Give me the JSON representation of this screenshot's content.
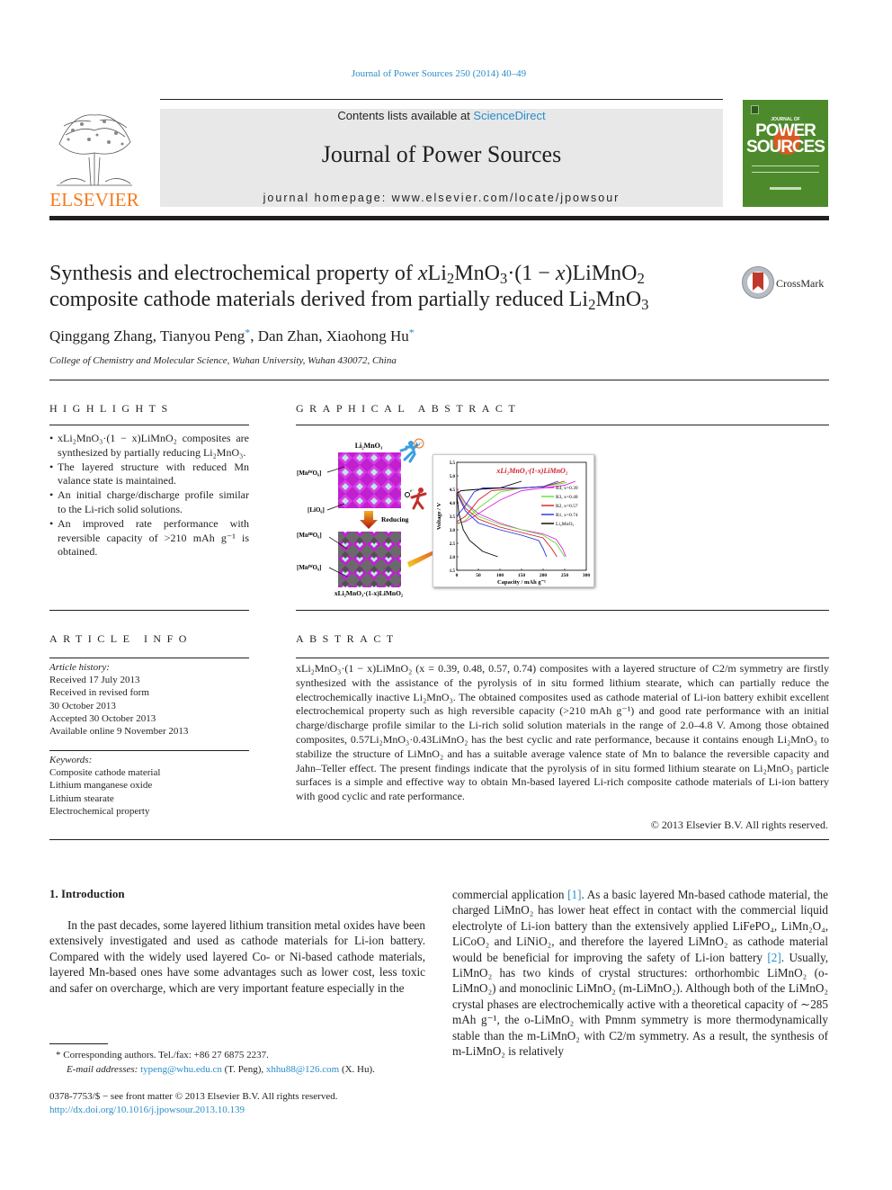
{
  "header": {
    "citation": "Journal of Power Sources 250 (2014) 40–49",
    "contents_prefix": "Contents lists available at ",
    "sciencedirect": "ScienceDirect",
    "journal_title": "Journal of Power Sources",
    "homepage": "journal homepage: www.elsevier.com/locate/jpowsour",
    "publisher_logo": "ELSEVIER",
    "cover": {
      "top": "JOURNAL OF",
      "title_line1": "POWER",
      "title_line2": "SOURCES"
    },
    "crossmark": "CrossMark"
  },
  "article": {
    "title_parts": {
      "a": "Synthesis and electrochemical property of ",
      "x1": "x",
      "b": "Li",
      "s1": "2",
      "c": "MnO",
      "s2": "3",
      "d": "·(1 − ",
      "x2": "x",
      "e": ")LiMnO",
      "s3": "2",
      "f": "composite cathode materials derived from partially reduced Li",
      "s4": "2",
      "g": "MnO",
      "s5": "3"
    },
    "authors": [
      {
        "name": "Qinggang Zhang",
        "corresponding": false
      },
      {
        "name": "Tianyou Peng",
        "corresponding": true
      },
      {
        "name": "Dan Zhan",
        "corresponding": false
      },
      {
        "name": "Xiaohong Hu",
        "corresponding": true
      }
    ],
    "affiliation": "College of Chemistry and Molecular Science, Wuhan University, Wuhan 430072, China"
  },
  "highlights": {
    "heading": "HIGHLIGHTS",
    "items": [
      "xLi₂MnO₃·(1 − x)LiMnO₂ composites are synthesized by partially reducing Li₂MnO₃.",
      "The layered structure with reduced Mn valance state is maintained.",
      "An initial charge/discharge profile similar to the Li-rich solid solutions.",
      "An improved rate performance with reversible capacity of >210 mAh g⁻¹ is obtained."
    ]
  },
  "graphical_abstract": {
    "heading": "GRAPHICAL ABSTRACT",
    "labels": {
      "top_compound": "Li₂MnO₃",
      "mn4_a": "[MnᴵⱽO₆]",
      "lio6": "[LiO₆]",
      "reducing": "Reducing",
      "mn3": "[MnᴵᴵᴵO₆]",
      "mn4_b": "[MnᴵⱽO₆]",
      "bottom_compound": "xLi₂MnO₃·(1-x)LiMnO₂",
      "li_plus": "Li⁺",
      "electron": "e⁻"
    }
  },
  "chart_data": {
    "type": "line",
    "title": "xLi₂MnO₃·(1-x)LiMnO₂",
    "xlabel": "Capacity / mAh g⁻¹",
    "ylabel": "Voltage / V",
    "xlim": [
      0,
      300
    ],
    "ylim": [
      1.5,
      5.5
    ],
    "xticks": [
      "0",
      "50",
      "100",
      "150",
      "200",
      "250",
      "300"
    ],
    "yticks": [
      "1.5",
      "2.0",
      "2.5",
      "3.0",
      "3.5",
      "4.0",
      "4.5",
      "5.0",
      "5.5"
    ],
    "legend_position": "right",
    "series": [
      {
        "name": "R4, x=0.39",
        "color": "#e020e0",
        "charge": [
          [
            0,
            3.25
          ],
          [
            20,
            3.3
          ],
          [
            50,
            3.6
          ],
          [
            100,
            4.1
          ],
          [
            150,
            4.45
          ],
          [
            200,
            4.55
          ],
          [
            250,
            4.65
          ],
          [
            275,
            4.8
          ]
        ],
        "discharge": [
          [
            0,
            4.5
          ],
          [
            20,
            4.0
          ],
          [
            50,
            3.6
          ],
          [
            100,
            3.25
          ],
          [
            150,
            3.0
          ],
          [
            200,
            2.85
          ],
          [
            230,
            2.65
          ],
          [
            245,
            2.3
          ],
          [
            253,
            2.0
          ]
        ]
      },
      {
        "name": "R3, x=0.48",
        "color": "#60e030",
        "charge": [
          [
            0,
            3.2
          ],
          [
            20,
            3.35
          ],
          [
            50,
            3.8
          ],
          [
            100,
            4.4
          ],
          [
            150,
            4.55
          ],
          [
            200,
            4.6
          ],
          [
            255,
            4.75
          ]
        ],
        "discharge": [
          [
            0,
            4.45
          ],
          [
            20,
            3.95
          ],
          [
            50,
            3.5
          ],
          [
            100,
            3.2
          ],
          [
            150,
            3.0
          ],
          [
            200,
            2.8
          ],
          [
            230,
            2.5
          ],
          [
            250,
            2.0
          ]
        ]
      },
      {
        "name": "R2, x=0.57",
        "color": "#d02020",
        "charge": [
          [
            0,
            3.3
          ],
          [
            20,
            3.5
          ],
          [
            50,
            4.1
          ],
          [
            80,
            4.45
          ],
          [
            150,
            4.55
          ],
          [
            200,
            4.6
          ],
          [
            250,
            4.8
          ]
        ],
        "discharge": [
          [
            0,
            4.4
          ],
          [
            20,
            3.8
          ],
          [
            50,
            3.4
          ],
          [
            100,
            3.1
          ],
          [
            150,
            2.9
          ],
          [
            200,
            2.7
          ],
          [
            220,
            2.3
          ],
          [
            232,
            2.0
          ]
        ]
      },
      {
        "name": "R1, x=0.74",
        "color": "#2030e0",
        "charge": [
          [
            0,
            3.5
          ],
          [
            20,
            3.9
          ],
          [
            40,
            4.4
          ],
          [
            60,
            4.55
          ],
          [
            150,
            4.55
          ],
          [
            200,
            4.6
          ],
          [
            235,
            4.8
          ]
        ],
        "discharge": [
          [
            0,
            4.35
          ],
          [
            20,
            3.7
          ],
          [
            50,
            3.25
          ],
          [
            100,
            3.0
          ],
          [
            150,
            2.8
          ],
          [
            190,
            2.6
          ],
          [
            200,
            2.3
          ],
          [
            208,
            2.0
          ]
        ]
      },
      {
        "name": "Li₂MnO₃",
        "color": "#000000",
        "charge": [
          [
            0,
            4.35
          ],
          [
            10,
            4.45
          ],
          [
            50,
            4.5
          ],
          [
            100,
            4.55
          ],
          [
            150,
            4.8
          ]
        ],
        "discharge": [
          [
            0,
            4.3
          ],
          [
            5,
            3.6
          ],
          [
            15,
            3.0
          ],
          [
            30,
            2.6
          ],
          [
            60,
            2.2
          ],
          [
            95,
            2.0
          ]
        ]
      }
    ]
  },
  "article_info": {
    "heading": "ARTICLE INFO",
    "history_label": "Article history:",
    "history": [
      "Received 17 July 2013",
      "Received in revised form",
      "30 October 2013",
      "Accepted 30 October 2013",
      "Available online 9 November 2013"
    ],
    "keywords_label": "Keywords:",
    "keywords": [
      "Composite cathode material",
      "Lithium manganese oxide",
      "Lithium stearate",
      "Electrochemical property"
    ]
  },
  "abstract": {
    "heading": "ABSTRACT",
    "text": "xLi₂MnO₃·(1 − x)LiMnO₂ (x = 0.39, 0.48, 0.57, 0.74) composites with a layered structure of C2/m symmetry are firstly synthesized with the assistance of the pyrolysis of in situ formed lithium stearate, which can partially reduce the electrochemically inactive Li₂MnO₃. The obtained composites used as cathode material of Li-ion battery exhibit excellent electrochemical property such as high reversible capacity (>210 mAh g⁻¹) and good rate performance with an initial charge/discharge profile similar to the Li-rich solid solution materials in the range of 2.0–4.8 V. Among those obtained composites, 0.57Li₂MnO₃·0.43LiMnO₂ has the best cyclic and rate performance, because it contains enough Li₂MnO₃ to stabilize the structure of LiMnO₂ and has a suitable average valence state of Mn to balance the reversible capacity and Jahn–Teller effect. The present findings indicate that the pyrolysis of in situ formed lithium stearate on Li₂MnO₃ particle surfaces is a simple and effective way to obtain Mn-based layered Li-rich composite cathode materials of Li-ion battery with good cyclic and rate performance.",
    "copyright": "© 2013 Elsevier B.V. All rights reserved."
  },
  "introduction": {
    "heading": "1.  Introduction",
    "col1": "In the past decades, some layered lithium transition metal oxides have been extensively investigated and used as cathode materials for Li-ion battery. Compared with the widely used layered Co- or Ni-based cathode materials, layered Mn-based ones have some advantages such as lower cost, less toxic and safer on overcharge, which are very important feature especially in the",
    "col2_a": "commercial application ",
    "ref1": "[1]",
    "col2_b": ". As a basic layered Mn-based cathode material, the charged LiMnO₂ has lower heat effect in contact with the commercial liquid electrolyte of Li-ion battery than the extensively applied LiFePO₄, LiMn₂O₄, LiCoO₂ and LiNiO₂, and therefore the layered LiMnO₂ as cathode material would be beneficial for improving the safety of Li-ion battery ",
    "ref2": "[2]",
    "col2_c": ". Usually, LiMnO₂ has two kinds of crystal structures: orthorhombic LiMnO₂ (o-LiMnO₂) and monoclinic LiMnO₂ (m-LiMnO₂). Although both of the LiMnO₂ crystal phases are electrochemically active with a theoretical capacity of ∼285 mAh g⁻¹, the o-LiMnO₂ with Pmnm symmetry is more thermodynamically stable than the m-LiMnO₂ with C2/m symmetry. As a result, the synthesis of m-LiMnO₂ is relatively"
  },
  "footnotes": {
    "corresponding": "* Corresponding authors. Tel./fax: +86 27 6875 2237.",
    "email_label": "E-mail addresses:",
    "email1": "typeng@whu.edu.cn",
    "email1_owner": " (T. Peng), ",
    "email2": "xhhu88@126.com",
    "email2_owner": " (X. Hu).",
    "issn": "0378-7753/$ − see front matter © 2013 Elsevier B.V. All rights reserved.",
    "doi": "http://dx.doi.org/10.1016/j.jpowsour.2013.10.139"
  },
  "colors": {
    "link": "#2a8dc8",
    "elsevier_orange": "#f47b20",
    "cover_green": "#4d8a2c",
    "banner_gray": "#e8e8e8"
  }
}
